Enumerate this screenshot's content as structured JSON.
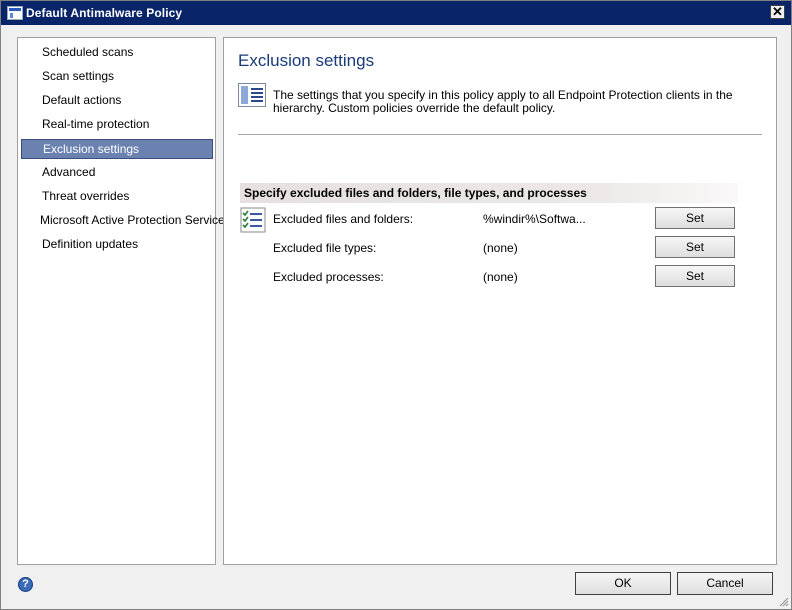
{
  "window": {
    "title": "Default Antimalware Policy",
    "close_glyph": "✕"
  },
  "nav": {
    "items": [
      {
        "label": "Scheduled scans"
      },
      {
        "label": "Scan settings"
      },
      {
        "label": "Default actions"
      },
      {
        "label": "Real-time protection"
      },
      {
        "label": "Exclusion settings",
        "selected": true
      },
      {
        "label": "Advanced"
      },
      {
        "label": "Threat overrides"
      },
      {
        "label": "Microsoft Active Protection Service"
      },
      {
        "label": "Definition updates"
      }
    ]
  },
  "main": {
    "title": "Exclusion settings",
    "description": "The settings that you specify in this policy apply to all Endpoint Protection clients in the hierarchy. Custom policies override the default policy.",
    "section_header": "Specify excluded files and folders, file types, and processes",
    "rows": [
      {
        "label": "Excluded files and folders:",
        "value": "%windir%\\Softwa...",
        "button": "Set"
      },
      {
        "label": "Excluded file types:",
        "value": "(none)",
        "button": "Set"
      },
      {
        "label": "Excluded processes:",
        "value": "(none)",
        "button": "Set"
      }
    ]
  },
  "footer": {
    "help_glyph": "?",
    "ok_label": "OK",
    "cancel_label": "Cancel"
  },
  "icons": {
    "window": "window-icon",
    "close": "close-icon",
    "info": "policy-info-icon",
    "list": "checklist-icon",
    "help": "help-icon",
    "grip": "resize-grip-icon"
  },
  "colors": {
    "titlebar": "#0a246a",
    "selection": "#6b82b0",
    "heading": "#1a3a7a"
  }
}
